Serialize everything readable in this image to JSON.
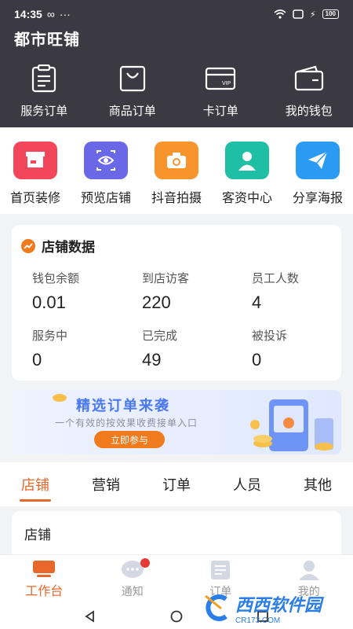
{
  "status_bar": {
    "time": "14:35"
  },
  "shop": {
    "title": "都市旺铺"
  },
  "order_tiles": [
    {
      "label": "服务订单",
      "icon": "clipboard-icon"
    },
    {
      "label": "商品订单",
      "icon": "shopping-bag-icon"
    },
    {
      "label": "卡订单",
      "icon": "vip-card-icon"
    },
    {
      "label": "我的钱包",
      "icon": "wallet-icon"
    }
  ],
  "tools": [
    {
      "label": "首页装修",
      "icon": "storefront-icon",
      "color": "#f2465a"
    },
    {
      "label": "预览店铺",
      "icon": "eye-icon",
      "color": "#6b68e8"
    },
    {
      "label": "抖音拍摄",
      "icon": "camera-icon",
      "color": "#f7942c"
    },
    {
      "label": "客资中心",
      "icon": "person-icon",
      "color": "#1fbfa5"
    },
    {
      "label": "分享海报",
      "icon": "paper-plane-icon",
      "color": "#2b9af3"
    }
  ],
  "store_data": {
    "title": "店铺数据",
    "stats": [
      {
        "label": "钱包余额",
        "value": "0.01"
      },
      {
        "label": "到店访客",
        "value": "220"
      },
      {
        "label": "员工人数",
        "value": "4"
      },
      {
        "label": "服务中",
        "value": "0"
      },
      {
        "label": "已完成",
        "value": "49"
      },
      {
        "label": "被投诉",
        "value": "0"
      }
    ]
  },
  "banner": {
    "headline": "精选订单来袭",
    "subtitle": "一个有效的按效果收费接单入口",
    "button": "立即参与"
  },
  "tabs": [
    "店铺",
    "营销",
    "订单",
    "人员",
    "其他"
  ],
  "active_tab": "店铺",
  "section": {
    "title": "店铺"
  },
  "bottom_nav": [
    {
      "label": "工作台",
      "icon": "workbench-icon",
      "active": true
    },
    {
      "label": "通知",
      "icon": "chat-bubble-icon",
      "active": false
    },
    {
      "label": "订单",
      "icon": "list-icon",
      "active": false
    },
    {
      "label": "我的",
      "icon": "user-icon",
      "active": false
    }
  ],
  "watermark": {
    "text": "西西软件园",
    "sub": "CR173.COM"
  },
  "colors": {
    "header_bg": "#3b3a42",
    "accent": "#e8672b",
    "banner_blue": "#4a78f0"
  }
}
